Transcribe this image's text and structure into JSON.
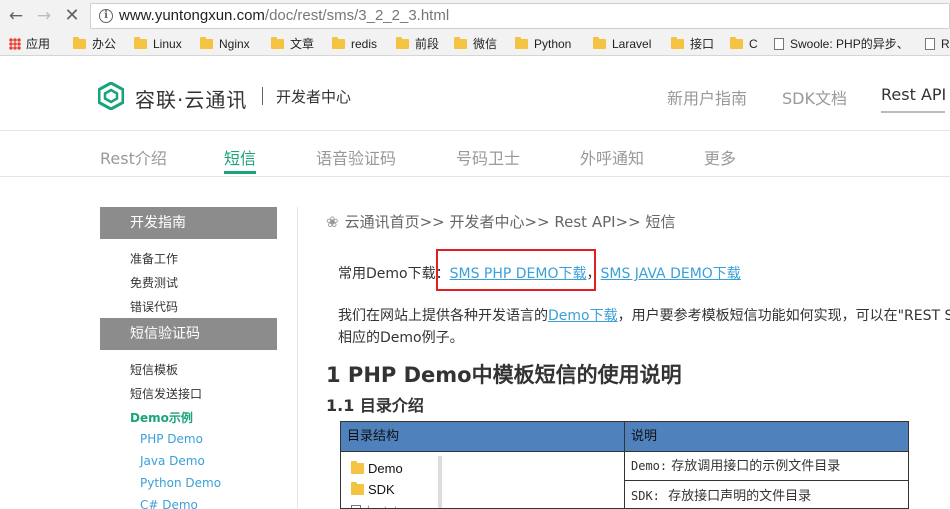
{
  "browser": {
    "url_host": "www.yuntongxun.com",
    "url_path": "/doc/rest/sms/3_2_2_3.html",
    "bookmarks": [
      {
        "label": "应用",
        "icon": "apps-icon"
      },
      {
        "label": "办公",
        "icon": "folder-icon"
      },
      {
        "label": "Linux",
        "icon": "folder-icon"
      },
      {
        "label": "Nginx",
        "icon": "folder-icon"
      },
      {
        "label": "文章",
        "icon": "folder-icon"
      },
      {
        "label": "redis",
        "icon": "folder-icon"
      },
      {
        "label": "前段",
        "icon": "folder-icon"
      },
      {
        "label": "微信",
        "icon": "folder-icon"
      },
      {
        "label": "Python",
        "icon": "folder-icon"
      },
      {
        "label": "Laravel",
        "icon": "folder-icon"
      },
      {
        "label": "接口",
        "icon": "folder-icon"
      },
      {
        "label": "C",
        "icon": "folder-icon"
      },
      {
        "label": "Swoole: PHP的异步、",
        "icon": "page-icon"
      },
      {
        "label": "R",
        "icon": "page-icon"
      }
    ]
  },
  "header": {
    "logo_text": "容联·云通讯",
    "logo_sub": "开发者中心",
    "links": [
      "新用户指南",
      "SDK文档",
      "Rest API"
    ],
    "active_link": "Rest API"
  },
  "product_nav": {
    "items": [
      "Rest介绍",
      "短信",
      "语音验证码",
      "号码卫士",
      "外呼通知",
      "更多"
    ],
    "active": "短信"
  },
  "sidebar": {
    "section1": "开发指南",
    "section1_items": [
      "准备工作",
      "免费测试",
      "错误代码"
    ],
    "section2": "短信验证码",
    "section2_items": [
      "短信模板",
      "短信发送接口",
      "Demo示例"
    ],
    "demo_items": [
      "PHP Demo",
      "Java Demo",
      "Python Demo",
      "C# Demo"
    ]
  },
  "content": {
    "breadcrumb": "云通讯首页>> 开发者中心>> Rest API>> 短信",
    "download_label": "常用Demo下载：",
    "php_demo_link": "SMS PHP DEMO下载",
    "comma": "，",
    "java_demo_link": "SMS JAVA DEMO下载",
    "para_before": "我们在网站上提供各种开发语言的",
    "para_link": "Demo下载",
    "para_after": "，用户要参考模板短信功能如何实现，可以在\"REST S",
    "para_line2": "相应的Demo例子。",
    "h1": "1 PHP Demo中模板短信的使用说明",
    "h2": "1.1 目录介绍"
  },
  "table": {
    "headers": [
      "目录结构",
      "说明"
    ],
    "tree": [
      "Demo",
      "SDK",
      "lostst"
    ],
    "rows": [
      {
        "key": "Demo:",
        "desc": "存放调用接口的示例文件目录"
      },
      {
        "key": "SDK:",
        "desc": "存放接口声明的文件目录"
      }
    ]
  },
  "colors": {
    "brand_green": "#1aa37a",
    "link_blue": "#3aa0d8",
    "table_header": "#4f81bd",
    "highlight_red": "#e02020"
  }
}
